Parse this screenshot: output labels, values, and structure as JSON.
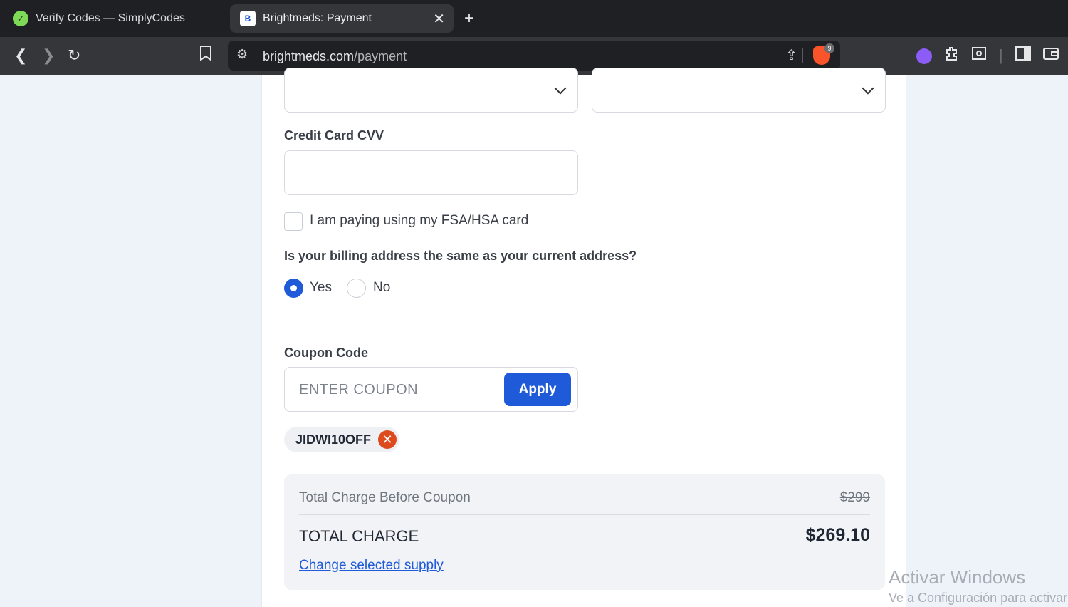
{
  "browser": {
    "tabs": [
      {
        "title": "Verify Codes — SimplyCodes",
        "favicon": "simplycodes-icon",
        "active": false
      },
      {
        "title": "Brightmeds: Payment",
        "favicon": "brightmeds-icon",
        "active": true
      }
    ],
    "url_host": "brightmeds.com",
    "url_path": "/payment",
    "shields_count": "9"
  },
  "form": {
    "cvv_label": "Credit Card CVV",
    "fsa_label": "I am paying using my FSA/HSA card",
    "billing_question": "Is your billing address the same as your current address?",
    "yes_label": "Yes",
    "no_label": "No",
    "coupon_label": "Coupon Code",
    "coupon_placeholder": "ENTER COUPON",
    "apply_label": "Apply",
    "applied_coupon": "JIDWI10OFF"
  },
  "summary": {
    "before_label": "Total Charge Before Coupon",
    "before_value": "$299",
    "total_label": "TOTAL CHARGE",
    "total_value": "$269.10",
    "change_link": "Change selected supply"
  },
  "watermark": {
    "line1": "Activar Windows",
    "line2": "Ve a Configuración para activar"
  },
  "colors": {
    "accent": "#1f5bd9",
    "remove": "#dd4b1c"
  }
}
